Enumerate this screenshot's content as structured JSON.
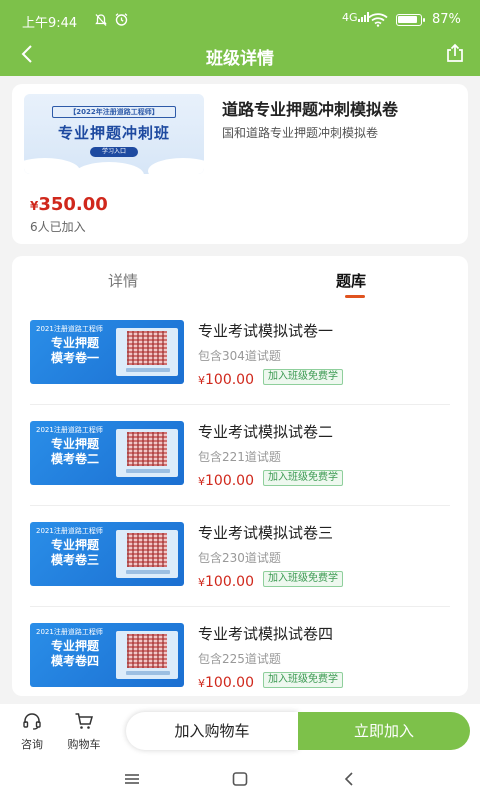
{
  "status_bar": {
    "time": "上午9:44",
    "signal": "4G",
    "battery": "87%"
  },
  "nav": {
    "title": "班级详情"
  },
  "product": {
    "cover": {
      "subtitle": "【2022年注册道路工程师】",
      "title": "专业押题冲刺班",
      "button": "学习入口"
    },
    "title": "道路专业押题冲刺模拟卷",
    "description": "国和道路专业押题冲刺模拟卷",
    "price_currency": "¥",
    "price": "350.00",
    "joined": "6人已加入"
  },
  "tabs": [
    {
      "label": "详情",
      "active": false
    },
    {
      "label": "题库",
      "active": true
    }
  ],
  "items": [
    {
      "thumb_head": "2021注册道路工程师",
      "thumb_line1": "专业押题",
      "thumb_line2": "模考卷一",
      "title": "专业考试模拟试卷一",
      "count": "包含304道试题",
      "currency": "¥",
      "price": "100.00",
      "badge": "加入班级免费学"
    },
    {
      "thumb_head": "2021注册道路工程师",
      "thumb_line1": "专业押题",
      "thumb_line2": "模考卷二",
      "title": "专业考试模拟试卷二",
      "count": "包含221道试题",
      "currency": "¥",
      "price": "100.00",
      "badge": "加入班级免费学"
    },
    {
      "thumb_head": "2021注册道路工程师",
      "thumb_line1": "专业押题",
      "thumb_line2": "模考卷三",
      "title": "专业考试模拟试卷三",
      "count": "包含230道试题",
      "currency": "¥",
      "price": "100.00",
      "badge": "加入班级免费学"
    },
    {
      "thumb_head": "2021注册道路工程师",
      "thumb_line1": "专业押题",
      "thumb_line2": "模考卷四",
      "title": "专业考试模拟试卷四",
      "count": "包含225道试题",
      "currency": "¥",
      "price": "100.00",
      "badge": "加入班级免费学"
    }
  ],
  "bottom": {
    "consult": "咨询",
    "cart": "购物车",
    "add_to_cart": "加入购物车",
    "join_now": "立即加入"
  },
  "colors": {
    "brand_green": "#7dc14a",
    "price_red": "#d0281c",
    "tab_accent": "#e0531f"
  }
}
